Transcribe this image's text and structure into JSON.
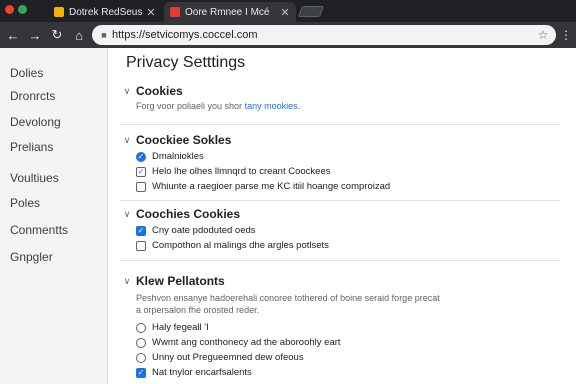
{
  "browser": {
    "tabs": [
      {
        "title": "Dotrek RedSeus",
        "active": false,
        "favicon_color": "#f4b400"
      },
      {
        "title": "Oore Rmnee I Mcé",
        "active": true,
        "favicon_color": "#e53935"
      }
    ],
    "window_dot_colors": [
      "#ea4335",
      "#34a853"
    ],
    "url": "https://setvicomys.coccel.com",
    "close_glyph": "✕"
  },
  "sidebar": {
    "items": [
      {
        "label": "Dolies",
        "active": true
      },
      {
        "label": "Dronrcts",
        "active": false
      },
      {
        "label": "Devolong",
        "active": false
      },
      {
        "label": "Prelians",
        "active": false
      },
      {
        "label": "Voultiues",
        "active": false
      },
      {
        "label": "Poles",
        "active": false
      },
      {
        "label": "Conmentts",
        "active": false
      },
      {
        "label": "Gnpgler",
        "active": false
      }
    ]
  },
  "page": {
    "title": "Privacy Setttings",
    "sections": [
      {
        "title": "Cookies",
        "description": "Forg voor poliaeli you shor",
        "link": "tany mookies.",
        "options": []
      },
      {
        "title": "Coockiee Sokles",
        "options": [
          {
            "label": "Dmalniokles",
            "control": "checkbox",
            "checked": true
          },
          {
            "label": "Helo lhe olhes llmnqrd to creant Coockees",
            "control": "checkbox",
            "checked": true
          },
          {
            "label": "Whiunte a raegioer parse me KC itiil hoange comproizad",
            "control": "checkbox",
            "checked": false
          }
        ]
      },
      {
        "title": "Coochies Cookies",
        "options": [
          {
            "label": "Cny oate pdoduted oeds",
            "control": "checkbox",
            "checked": true
          },
          {
            "label": "Compothon al malings dhe argles potlsets",
            "control": "checkbox",
            "checked": false
          }
        ]
      },
      {
        "title": "Klew Pellatonts",
        "description": "Peshvon ensanye hadoerehali conoree tothered of boine seraid forge precat a orpersalon fhe orosted reder.",
        "options": [
          {
            "label": "Haly fegeall 'I",
            "control": "radio",
            "checked": false
          },
          {
            "label": "Wwmt ang conthonecy ad the aboroohly eart",
            "control": "radio",
            "checked": false
          },
          {
            "label": "Unny out Pregueemned dew ofeous",
            "control": "radio",
            "checked": false
          },
          {
            "label": "Nat tnylor encarfsalents",
            "control": "radio",
            "checked": true
          }
        ]
      }
    ]
  }
}
